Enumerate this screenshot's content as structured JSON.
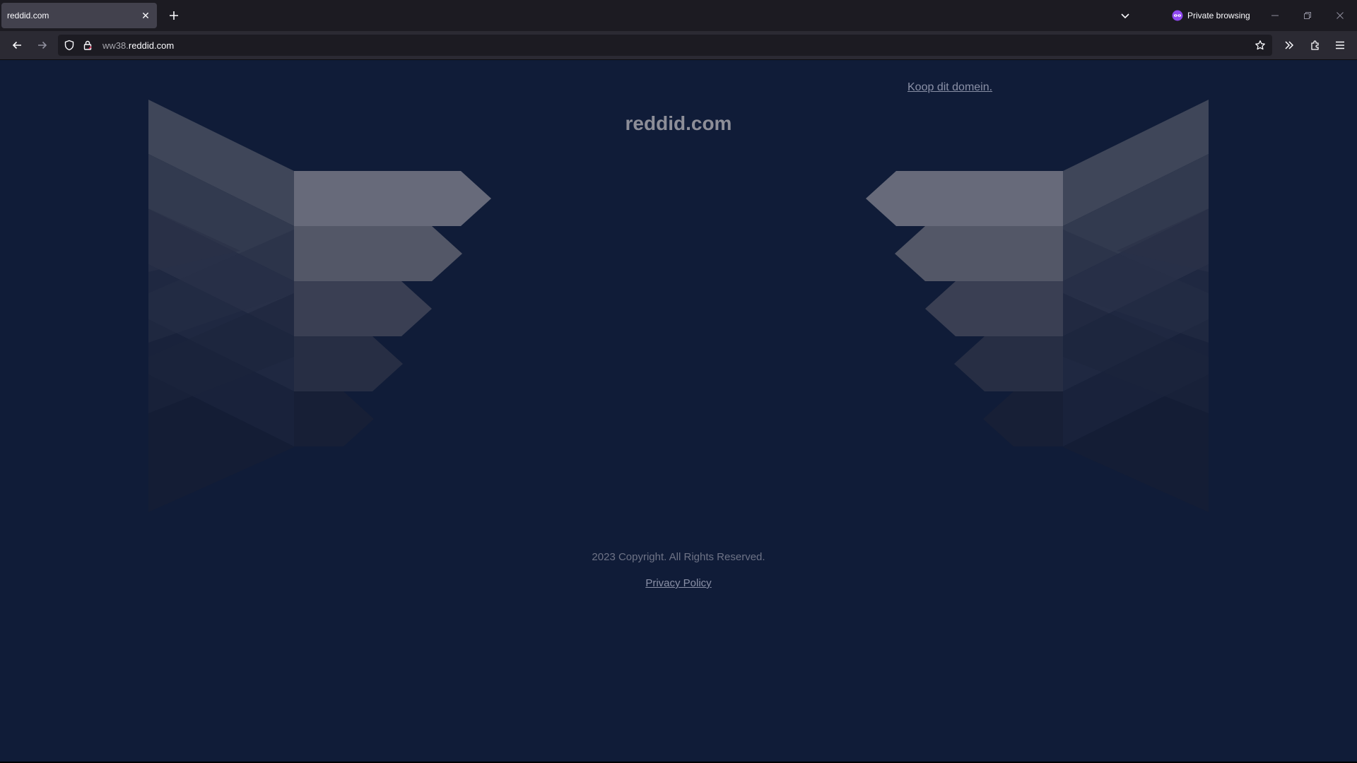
{
  "browser": {
    "tab": {
      "title": "reddid.com",
      "close_glyph": "✕"
    },
    "new_tab_glyph": "+",
    "private_label": "Private browsing",
    "url": {
      "prefix": "ww38.",
      "domain": "reddid.com"
    },
    "icons": {
      "back": "arrow-left-icon",
      "forward": "arrow-right-icon",
      "shield": "shield-icon",
      "lock": "lock-icon",
      "bookmark": "star-icon",
      "overflow": "double-chevron-icon",
      "extensions": "puzzle-icon",
      "menu": "hamburger-icon"
    }
  },
  "page": {
    "buy_link": "Koop dit domein.",
    "domain_title": "reddid.com",
    "copyright": "2023 Copyright. All Rights Reserved.",
    "privacy_link": "Privacy Policy"
  },
  "colors": {
    "page_background": "#101c38",
    "titlebar": "#1c1b22",
    "toolbar": "#2b2a33",
    "private_accent": "#8f48f0"
  }
}
